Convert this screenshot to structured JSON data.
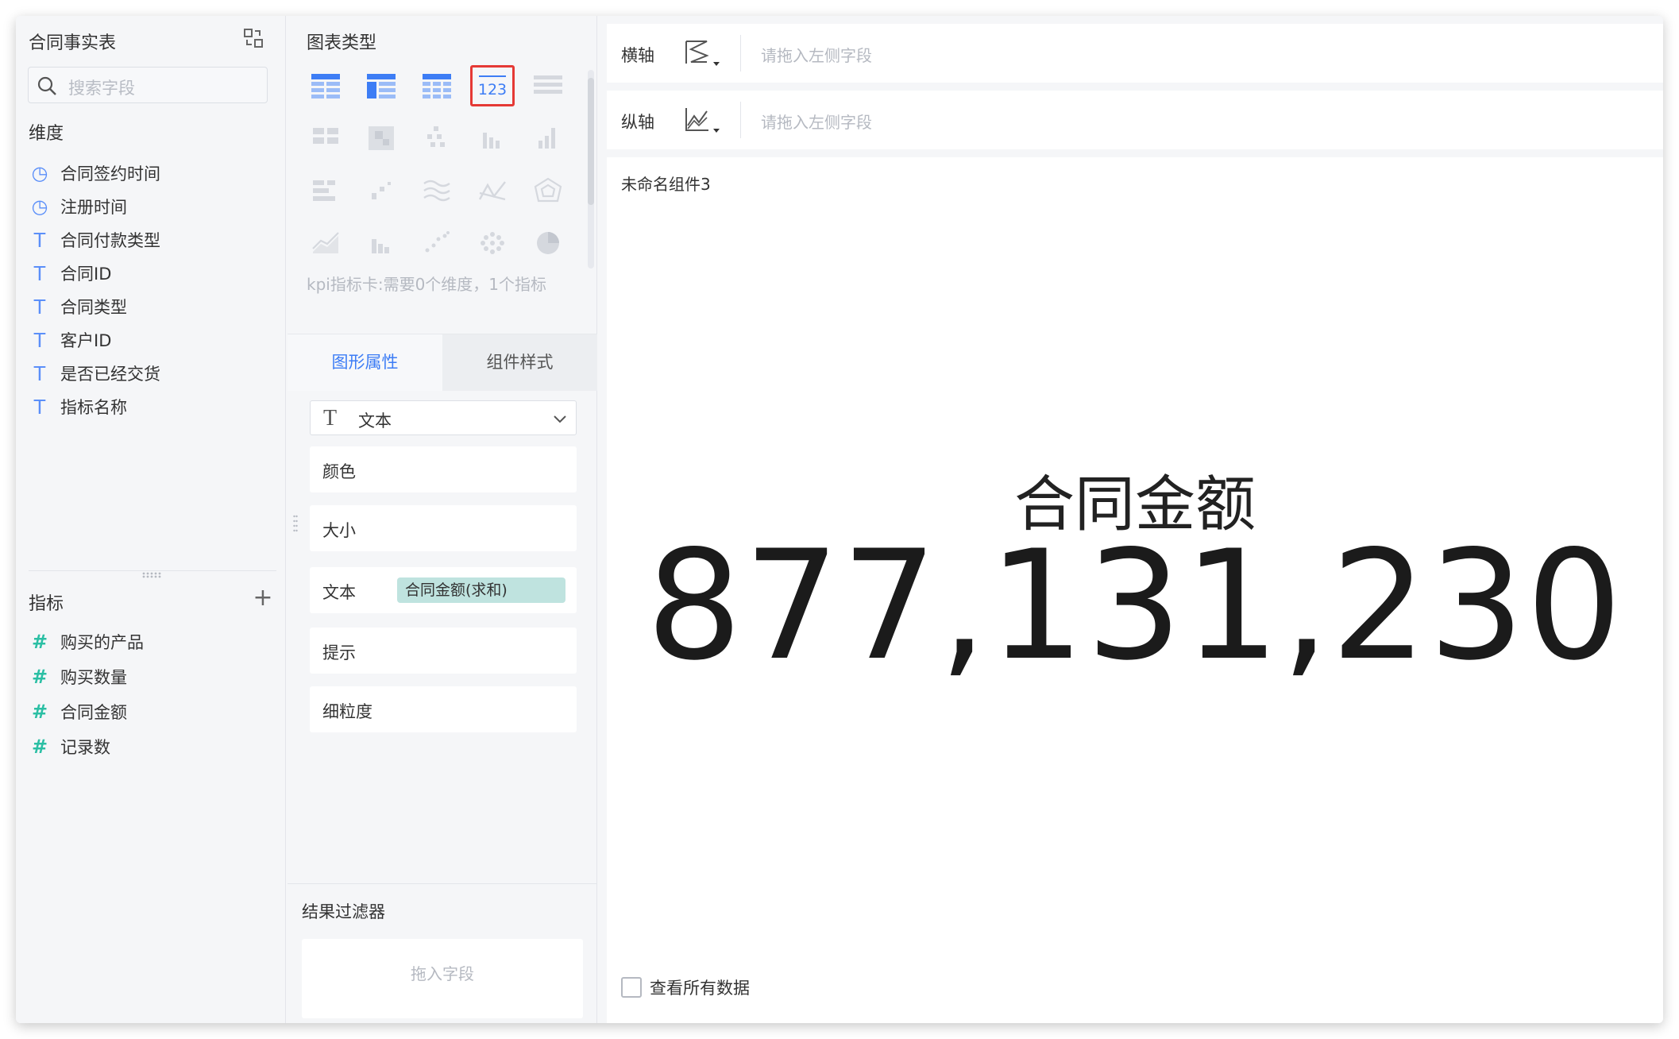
{
  "left_panel": {
    "title": "合同事实表",
    "search_placeholder": "搜索字段",
    "dimensions_label": "维度",
    "dimensions": [
      {
        "icon": "clock-icon",
        "label": "合同签约时间"
      },
      {
        "icon": "clock-icon",
        "label": "注册时间"
      },
      {
        "icon": "text-type-icon",
        "label": "合同付款类型"
      },
      {
        "icon": "text-type-icon",
        "label": "合同ID"
      },
      {
        "icon": "text-type-icon",
        "label": "合同类型"
      },
      {
        "icon": "text-type-icon",
        "label": "客户ID"
      },
      {
        "icon": "text-type-icon",
        "label": "是否已经交货"
      },
      {
        "icon": "text-type-icon",
        "label": "指标名称"
      }
    ],
    "metrics_label": "指标",
    "metrics": [
      {
        "icon": "hash-icon",
        "label": "购买的产品"
      },
      {
        "icon": "hash-icon",
        "label": "购买数量"
      },
      {
        "icon": "hash-icon",
        "label": "合同金额"
      },
      {
        "icon": "hash-icon",
        "label": "记录数"
      }
    ]
  },
  "middle_panel": {
    "chart_type_title": "图表类型",
    "chart_type_hint": "kpi指标卡:需要0个维度，1个指标",
    "selected_chart_type": "kpi-card",
    "tabs": [
      {
        "label": "图形属性",
        "active": true
      },
      {
        "label": "组件样式",
        "active": false
      }
    ],
    "mark_type": "文本",
    "properties": {
      "color": "颜色",
      "size": "大小",
      "text": "文本",
      "text_field": "合同金额(求和)",
      "tooltip": "提示",
      "granularity": "细粒度"
    },
    "filter_title": "结果过滤器",
    "filter_drop_hint": "拖入字段"
  },
  "canvas": {
    "x_axis_label": "横轴",
    "y_axis_label": "纵轴",
    "axis_placeholder": "请拖入左侧字段",
    "widget_title": "未命名组件3",
    "kpi_label": "合同金额",
    "kpi_value": "877,131,230",
    "view_all_label": "查看所有数据"
  },
  "colors": {
    "accent": "#3d7df5",
    "selection": "#e53935",
    "field_pill": "#bfe3df",
    "metric_icon": "#2bbfa4",
    "dimension_icon": "#5b8ff9"
  }
}
